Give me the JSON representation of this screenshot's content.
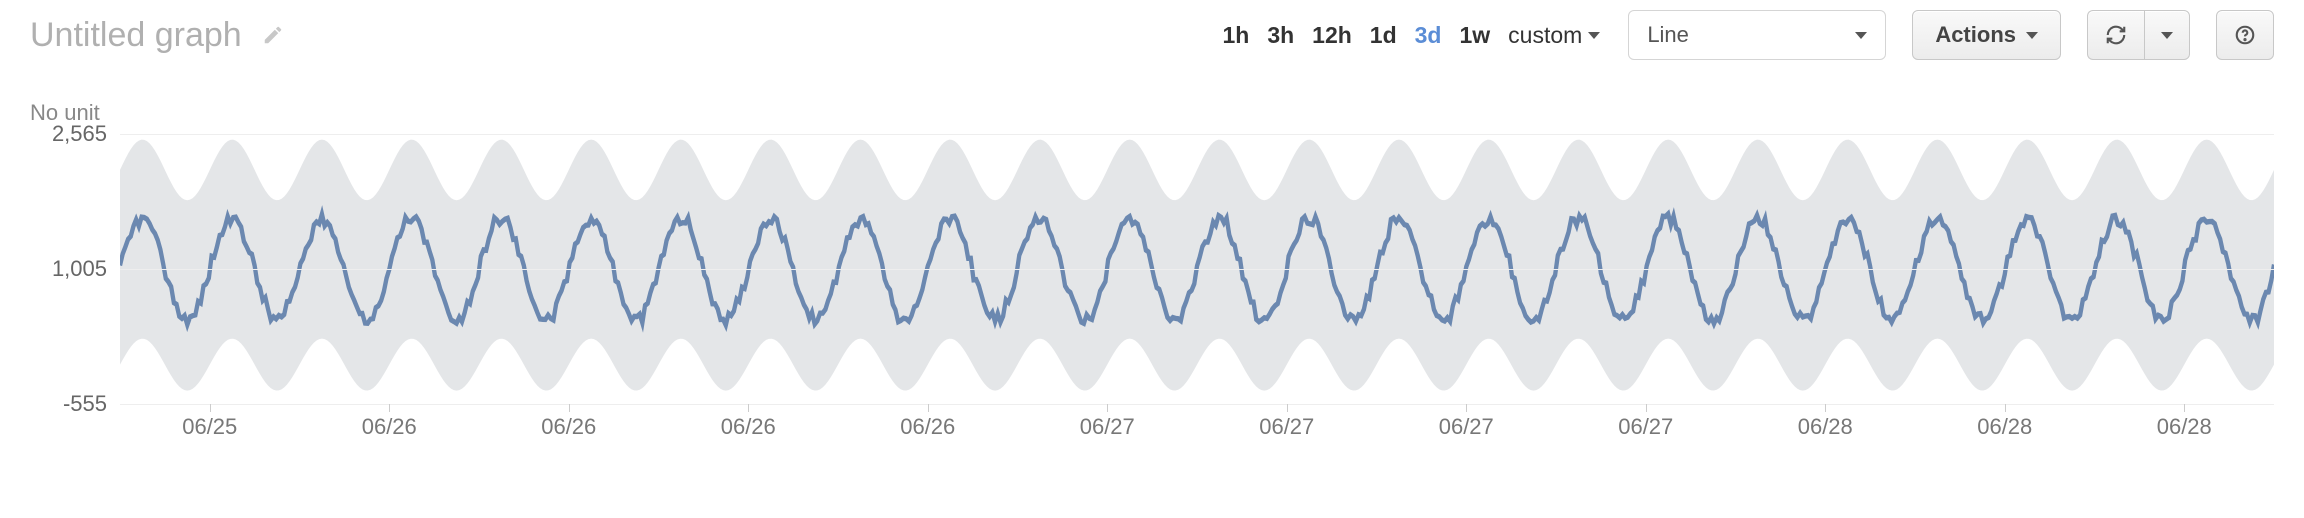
{
  "header": {
    "title": "Untitled graph",
    "chart_type": "Line",
    "actions_label": "Actions"
  },
  "time_range": {
    "options": [
      "1h",
      "3h",
      "12h",
      "1d",
      "3d",
      "1w"
    ],
    "custom_label": "custom",
    "active": "3d"
  },
  "chart_data": {
    "type": "line",
    "title": "Untitled graph",
    "unit_label": "No unit",
    "ylim": [
      -555,
      2565
    ],
    "y_ticks": [
      -555,
      1005,
      2565
    ],
    "x_ticks": [
      "06/25",
      "06/26",
      "06/26",
      "06/26",
      "06/26",
      "06/27",
      "06/27",
      "06/27",
      "06/27",
      "06/28",
      "06/28",
      "06/28"
    ],
    "band": {
      "low_base": 200,
      "high_base": 1800,
      "amplitude_low": 600,
      "amplitude_high": 700
    },
    "line": {
      "base": 1000,
      "amplitude": 650,
      "noise": 120
    },
    "cycles": 24
  }
}
